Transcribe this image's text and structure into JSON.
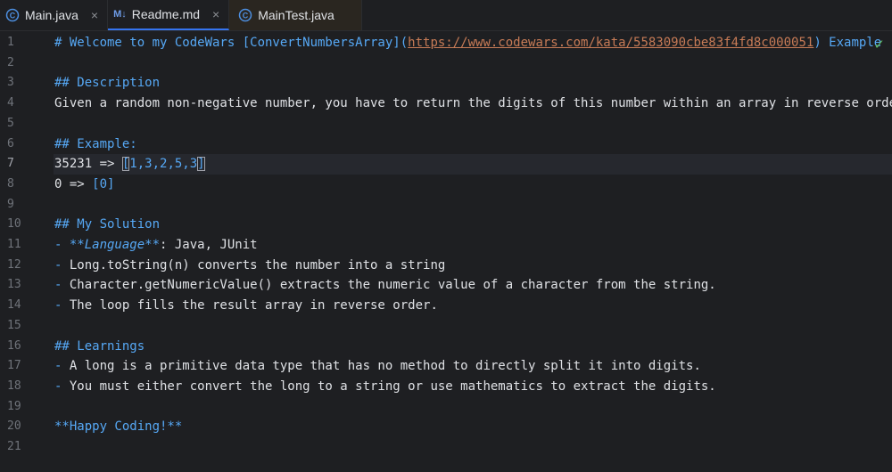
{
  "tabs": [
    {
      "name": "Main.java",
      "icon": "java-class-icon",
      "close": "×"
    },
    {
      "name": "Readme.md",
      "icon": "markdown-icon",
      "badge": "M↓",
      "close": "×"
    },
    {
      "name": "MainTest.java",
      "icon": "java-class-icon"
    }
  ],
  "editor": {
    "line_numbers": [
      "1",
      "2",
      "3",
      "4",
      "5",
      "6",
      "7",
      "8",
      "9",
      "10",
      "11",
      "12",
      "13",
      "14",
      "15",
      "16",
      "17",
      "18",
      "19",
      "20",
      "21"
    ],
    "current_line": 7,
    "l1_a": "# Welcome to my CodeWars [ConvertNumbersArray](",
    "l1_link": "https://www.codewars.com/kata/5583090cbe83f4fd8c000051",
    "l1_b": ") Example",
    "l3": "## Description",
    "l4": "Given a random non-negative number, you have to return the digits of this number within an array in reverse order.",
    "l6": "## Example:",
    "l7_a": "35231 => ",
    "l7_lb": "[",
    "l7_v": "1,3,2,5,3",
    "l7_rb": "]",
    "l8_a": "0 => ",
    "l8_v": "[0]",
    "l10": "## My Solution",
    "l11_dash": "- ",
    "l11_b": "**Language**",
    "l11_rest": ": Java, JUnit",
    "l12_dash": "- ",
    "l12": "Long.toString(n) converts the number into a string",
    "l13_dash": "- ",
    "l13": "Character.getNumericValue() extracts the numeric value of a character from the string.",
    "l14_dash": "- ",
    "l14": "The loop fills the result array in reverse order.",
    "l16": "## Learnings",
    "l17_dash": "- ",
    "l17": "A long is a primitive data type that has no method to directly split it into digits.",
    "l18_dash": "- ",
    "l18": "You must either convert the long to a string or use mathematics to extract the digits.",
    "l20": "**Happy Coding!**",
    "status_icon": "checkmark-icon",
    "status_symbol": "✓"
  },
  "colors": {
    "background": "#1e1f22",
    "heading": "#56a8f5",
    "link": "#c77b56",
    "check": "#5fb865",
    "active_tab_underline": "#3574f0"
  }
}
